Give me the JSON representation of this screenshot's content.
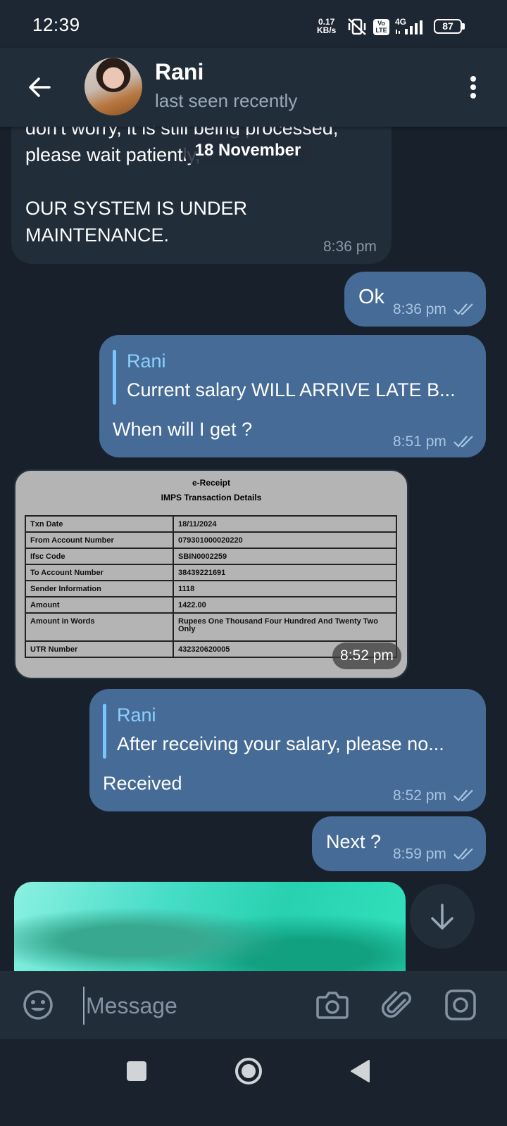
{
  "status_bar": {
    "time": "12:39",
    "speed_value": "0.17",
    "speed_unit": "KB/s",
    "volte_top": "Vo",
    "volte_bottom": "LTE",
    "network": "4G",
    "battery": "87"
  },
  "header": {
    "name": "Rani",
    "status": "last seen recently"
  },
  "date_pill": "18 November",
  "messages": {
    "m0": {
      "text_line1": "don't worry, it is still being processed,",
      "text_line2": "please wait patiently,",
      "text_line3": "OUR SYSTEM IS UNDER",
      "text_line4": "MAINTENANCE.",
      "time": "8:36 pm"
    },
    "m1": {
      "text": "Ok",
      "time": "8:36 pm"
    },
    "m2": {
      "reply_name": "Rani",
      "reply_text": "Current salary WILL ARRIVE LATE B...",
      "text": "When will I get ?",
      "time": "8:51 pm"
    },
    "m3": {
      "time": "8:52 pm",
      "receipt": {
        "title": "e-Receipt",
        "subtitle": "IMPS Transaction Details",
        "rows": [
          [
            "Txn Date",
            "18/11/2024"
          ],
          [
            "From Account Number",
            "079301000020220"
          ],
          [
            "Ifsc Code",
            "SBIN0002259"
          ],
          [
            "To Account Number",
            "38439221691"
          ],
          [
            "Sender Information",
            "1118"
          ],
          [
            "Amount",
            "1422.00"
          ],
          [
            "Amount in Words",
            "Rupees One Thousand Four Hundred And Twenty Two Only"
          ],
          [
            "UTR Number",
            "432320620005"
          ]
        ]
      }
    },
    "m4": {
      "reply_name": "Rani",
      "reply_text": "After receiving your salary, please no...",
      "text": "Received",
      "time": "8:52 pm"
    },
    "m5": {
      "text": "Next ?",
      "time": "8:59 pm"
    }
  },
  "composer": {
    "placeholder": "Message"
  },
  "icons": {
    "back": "arrow-left-icon",
    "menu": "more-vertical-icon",
    "emoji": "emoji-icon",
    "camera": "camera-icon",
    "attach": "paperclip-icon",
    "video": "video-message-icon",
    "scroll": "arrow-down-icon",
    "nav_recents": "square-icon",
    "nav_home": "circle-icon",
    "nav_back": "triangle-back-icon"
  },
  "colors": {
    "background": "#18212b",
    "header": "#222d3a",
    "incoming_bubble": "#222d3a",
    "outgoing_bubble": "#456b96",
    "accent_reply": "#7cc4ff"
  }
}
